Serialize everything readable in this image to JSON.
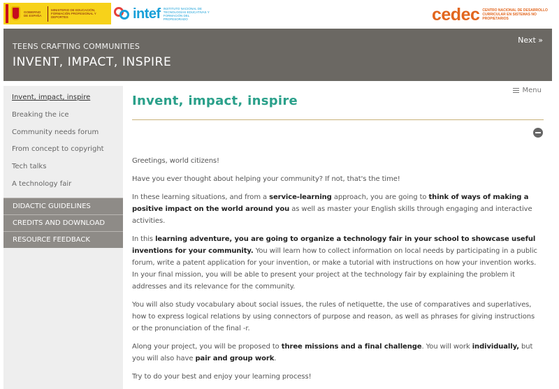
{
  "logos": {
    "gov_text_1": "GOBIERNO DE ESPAÑA",
    "gov_text_2": "MINISTERIO DE EDUCACIÓN, FORMACIÓN PROFESIONAL Y DEPORTES",
    "intef_word": "intef",
    "intef_sub": "INSTITUTO NACIONAL DE TECNOLOGÍAS EDUCATIVAS Y FORMACIÓN DEL PROFESORADO",
    "cedec_word": "cedec",
    "cedec_sub": "CENTRO NACIONAL DE DESARROLLO CURRICULAR EN SISTEMAS NO PROPIETARIOS"
  },
  "header": {
    "kicker": "TEENS CRAFTING COMMUNITIES",
    "title": "INVENT, IMPACT, INSPIRE",
    "next_label": "Next »"
  },
  "sidebar": {
    "items": [
      "Invent, impact, inspire",
      "Breaking the ice",
      "Community needs forum",
      "From concept to copyright",
      "Tech talks",
      "A technology fair"
    ],
    "buttons": [
      "DIDACTIC GUIDELINES",
      "CREDITS AND DOWNLOAD",
      "RESOURCE FEEDBACK"
    ]
  },
  "main": {
    "menu_label": "Menu",
    "title": "Invent, impact, inspire",
    "greeting": "Greetings, world citizens!",
    "p1": "Have you ever thought about helping your community? If not, that's the time!",
    "p2": {
      "a": "In these learning situations, and from a ",
      "b": "service-learning",
      "c": " approach, you are going to ",
      "d": "think of ways of making a positive impact on the world around you",
      "e": " as well as master your English skills through engaging and interactive activities."
    },
    "p3": {
      "a": "In this ",
      "b": "learning adventure, you are going to organize a technology fair in your school to showcase useful inventions for your community.",
      "c": " You will learn how to collect information on local needs by participating in a public forum, write a patent application for your invention, or make a tutorial with instructions on how your invention works. In your final mission, you will be able to present your project at the technology fair by explaining the problem it addresses and its relevance for the community."
    },
    "p4": "You will also study vocabulary about social issues, the rules of netiquette, the use of comparatives and superlatives, how to express logical relations by using connectors of purpose and reason, as well as phrases for giving instructions or the pronunciation of the final -r.",
    "p5": {
      "a": "Along your project, you will be proposed to ",
      "b": "three missions and a final challenge",
      "c": ". You will work ",
      "d": "individually,",
      "e": " but you will also have ",
      "f": "pair and group work",
      "g": "."
    },
    "p6": "Try to do your best and enjoy your learning process!"
  }
}
